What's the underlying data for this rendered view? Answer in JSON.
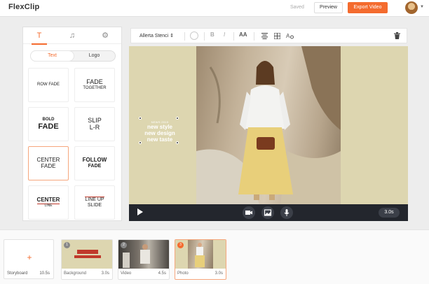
{
  "app": {
    "logo": "FlexClip"
  },
  "header": {
    "saved": "Saved",
    "preview_label": "Preview",
    "export_label": "Export Video",
    "accent": "#f46b2e"
  },
  "panel": {
    "tabs": [
      {
        "icon": "text-icon",
        "glyph": "T"
      },
      {
        "icon": "music-icon",
        "glyph": "♫"
      },
      {
        "icon": "settings-icon",
        "glyph": "⚙"
      }
    ],
    "segment": {
      "text_label": "Text",
      "logo_label": "Logo"
    },
    "styles": [
      {
        "l1": "ROW FADE",
        "l2": ""
      },
      {
        "l1": "FADE",
        "l2": "TOGETHER"
      },
      {
        "l1": "BOLD",
        "l2": "FADE"
      },
      {
        "l1": "SLIP",
        "l2": "L-R"
      },
      {
        "l1": "CENTER",
        "l2": "FADE"
      },
      {
        "l1": "FOLLOW",
        "l2": "FADE"
      },
      {
        "l1": "CENTER",
        "l2": "LINE"
      },
      {
        "l1": "LINE UP",
        "l2": "SLIDE"
      }
    ]
  },
  "toolbar": {
    "font_name": "Allerta Stenci ⇕",
    "bold": "B",
    "italic": "I",
    "case": "AA"
  },
  "canvas": {
    "overlay_small": "NEWS 2019",
    "overlay_lines": [
      "new style",
      "new design",
      "new taste"
    ],
    "bg_color": "#ddd6b0"
  },
  "player": {
    "duration": "3.0s"
  },
  "storyboard": {
    "label": "Storyboard",
    "total": "10.5s",
    "clips": [
      {
        "num": "1",
        "label": "Background",
        "duration": "3.0s"
      },
      {
        "num": "2",
        "label": "Video",
        "duration": "4.5s"
      },
      {
        "num": "3",
        "label": "Photo",
        "duration": "3.0s"
      }
    ]
  }
}
